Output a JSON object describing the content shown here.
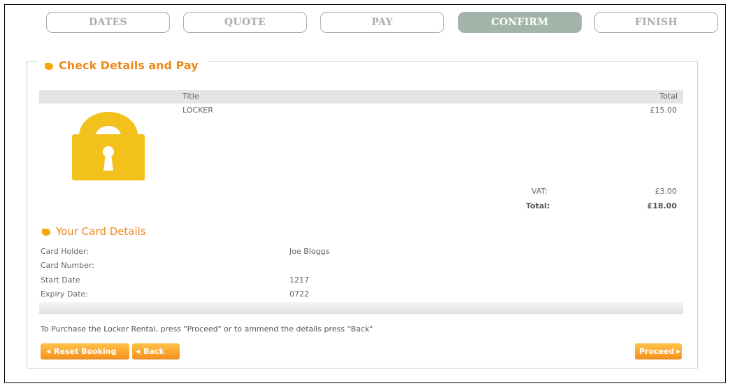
{
  "steps": {
    "dates": "DATES",
    "quote": "QUOTE",
    "pay": "PAY",
    "confirm": "CONFIRM",
    "finish": "FINISH",
    "active": "CONFIRM"
  },
  "section": {
    "title": "Check Details and Pay"
  },
  "order": {
    "columns": {
      "title": "Title",
      "total": "Total"
    },
    "item": {
      "title": "LOCKER",
      "total": "£15.00",
      "icon": "padlock-icon"
    },
    "vat_label": "VAT:",
    "vat_value": "£3.00",
    "total_label": "Total:",
    "total_value": "£18.00"
  },
  "card": {
    "heading": "Your Card Details",
    "holder_label": "Card Holder:",
    "holder_value": "Joe Bloggs",
    "number_label": "Card Number:",
    "number_value": "",
    "start_label": "Start Date",
    "start_value": "1217",
    "expiry_label": "Expiry Date:",
    "expiry_value": "0722"
  },
  "notice": "To Purchase the Locker Rental, press \"Proceed\" or to ammend the details press \"Back\"",
  "buttons": {
    "reset": "Reset Booking",
    "back": "Back",
    "proceed": "Proceed"
  },
  "colors": {
    "accent_orange": "#ec8a1a",
    "step_active": "#a3b4aa",
    "lock_yellow": "#f2c11c"
  }
}
